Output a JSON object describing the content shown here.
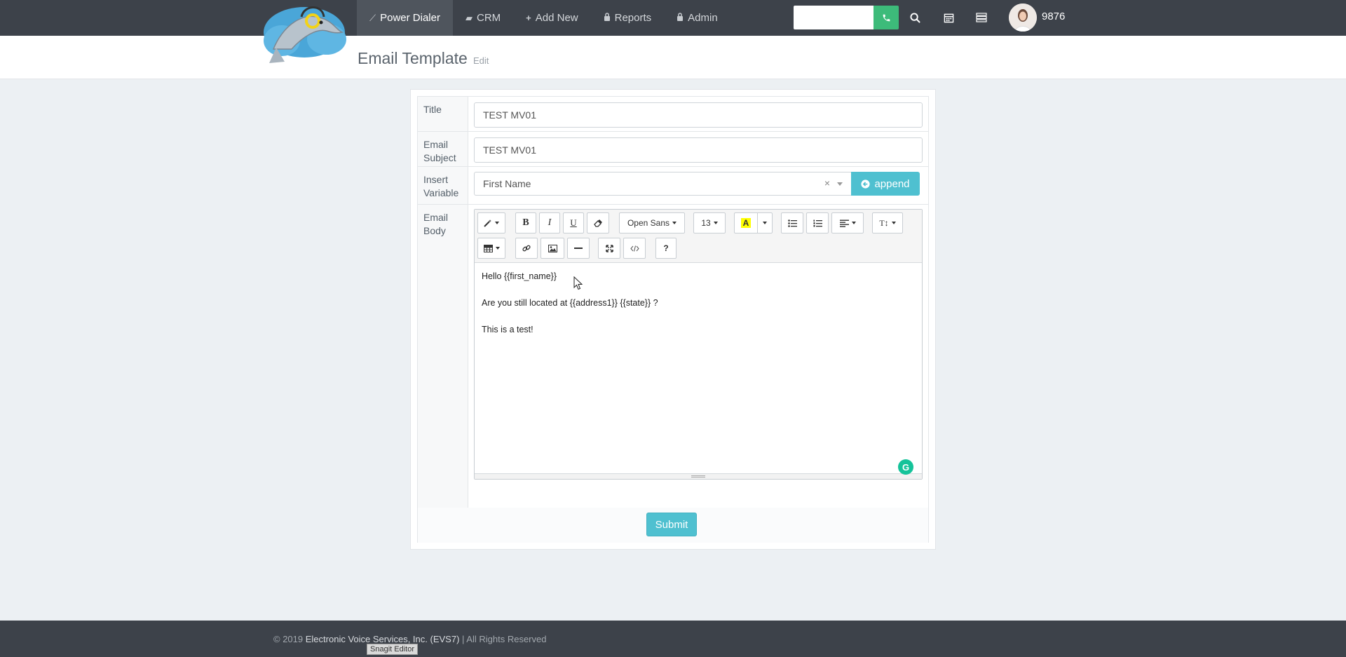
{
  "nav": {
    "items": [
      {
        "label": "Power Dialer",
        "icon": "wand-icon",
        "active": true
      },
      {
        "label": "CRM",
        "icon": "book-icon"
      },
      {
        "label": "Add New",
        "icon": "plus-icon"
      },
      {
        "label": "Reports",
        "icon": "lock-icon"
      },
      {
        "label": "Admin",
        "icon": "lock-icon"
      }
    ],
    "dial_placeholder": "",
    "user_ext": "9876"
  },
  "header": {
    "title": "Email Template",
    "subtitle": "Edit"
  },
  "form": {
    "title_label": "Title",
    "title_value": "TEST MV01",
    "subject_label": "Email Subject",
    "subject_value": "TEST MV01",
    "variable_label": "Insert Variable",
    "variable_selected": "First Name",
    "variable_clear": "×",
    "append_label": "append",
    "body_label": "Email Body",
    "body_lines": [
      "Hello {{first_name}}",
      "Are you still located at {{address1}} {{state}} ?",
      "This is a test!"
    ],
    "submit_label": "Submit"
  },
  "toolbar": {
    "font_name": "Open Sans",
    "font_size": "13",
    "bold": "B",
    "italic": "I",
    "underline": "U",
    "help": "?",
    "highlight": "A",
    "text_style": "T↕",
    "highlight_color": "#ffff00"
  },
  "footer": {
    "copyright": "© 2019",
    "company": "Electronic Voice Services, Inc. (EVS7)",
    "rights": "| All Rights Reserved"
  },
  "overlay": {
    "snagit": "Snagit Editor"
  },
  "colors": {
    "navbar": "#3d424a",
    "accent": "#4fc0d0",
    "dial_green": "#3dbb7a"
  }
}
